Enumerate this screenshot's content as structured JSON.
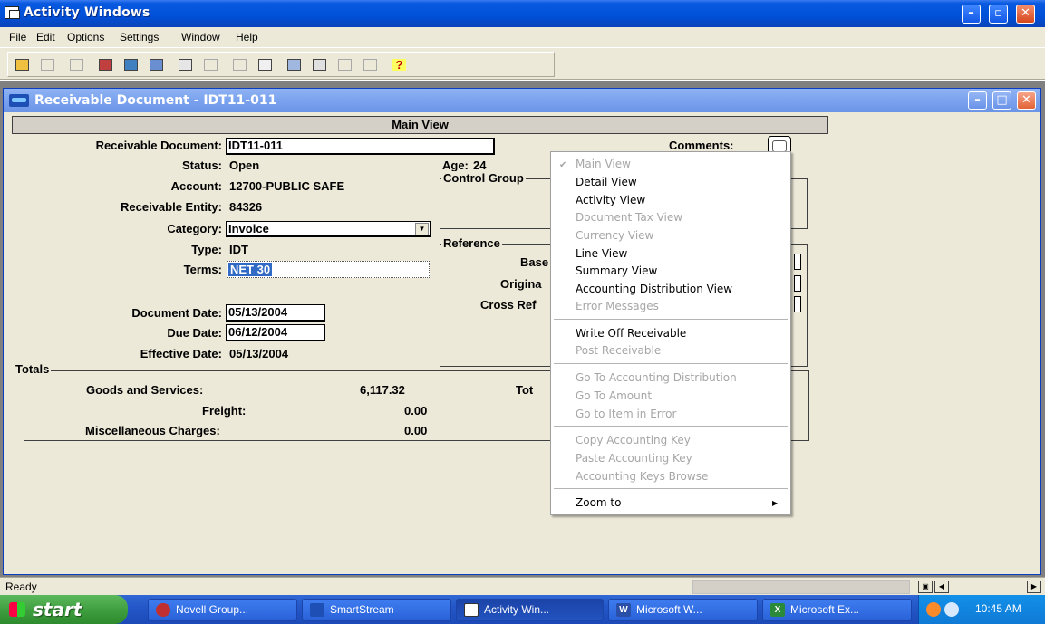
{
  "app": {
    "title": "Activity Windows",
    "menu": [
      "File",
      "Edit",
      "Options",
      "Settings",
      "Window",
      "Help"
    ]
  },
  "child": {
    "title": "Receivable Document -  IDT11-011",
    "view_title": "Main View"
  },
  "form": {
    "receivable_document_label": "Receivable Document:",
    "receivable_document": "IDT11-011",
    "status_label": "Status:",
    "status": "Open",
    "account_label": "Account:",
    "account": "12700-PUBLIC SAFE",
    "receivable_entity_label": "Receivable Entity:",
    "receivable_entity": "84326",
    "category_label": "Category:",
    "category": "Invoice",
    "type_label": "Type:",
    "type": "IDT",
    "terms_label": "Terms:",
    "terms": "NET 30",
    "document_date_label": "Document Date:",
    "document_date": "05/13/2004",
    "due_date_label": "Due Date:",
    "due_date": "06/12/2004",
    "effective_date_label": "Effective Date:",
    "effective_date": "05/13/2004",
    "age_label": "Age:",
    "age": "24",
    "comments_label": "Comments:",
    "control_group_title": "Control Group",
    "reference_title": "Reference",
    "reference_labels": [
      "Base",
      "Origina",
      "Cross Ref"
    ]
  },
  "totals": {
    "title": "Totals",
    "goods_label": "Goods and Services:",
    "goods_value": "6,117.32",
    "freight_label": "Freight:",
    "freight_value": "0.00",
    "misc_label": "Miscellaneous Charges:",
    "misc_value": "0.00",
    "total_label": "Tot"
  },
  "context_menu": {
    "items": [
      {
        "label": "Main View",
        "enabled": false,
        "checked": true
      },
      {
        "label": "Detail View",
        "enabled": true
      },
      {
        "label": "Activity View",
        "enabled": true
      },
      {
        "label": "Document Tax View",
        "enabled": false
      },
      {
        "label": "Currency View",
        "enabled": false
      },
      {
        "label": "Line View",
        "enabled": true
      },
      {
        "label": "Summary View",
        "enabled": true
      },
      {
        "label": "Accounting Distribution View",
        "enabled": true
      },
      {
        "label": "Error Messages",
        "enabled": false
      },
      {
        "label": "Write Off Receivable",
        "enabled": true
      },
      {
        "label": "Post Receivable",
        "enabled": false
      },
      {
        "label": "Go To Accounting Distribution",
        "enabled": false
      },
      {
        "label": "Go To Amount",
        "enabled": false
      },
      {
        "label": "Go to Item in Error",
        "enabled": false
      },
      {
        "label": "Copy Accounting Key",
        "enabled": false
      },
      {
        "label": "Paste Accounting Key",
        "enabled": false
      },
      {
        "label": "Accounting Keys Browse",
        "enabled": false
      },
      {
        "label": "Zoom to",
        "enabled": true,
        "submenu": true
      }
    ]
  },
  "status": {
    "text": "Ready"
  },
  "taskbar": {
    "start_label": "start",
    "tasks": [
      "Novell Group...",
      "SmartStream",
      "Activity Win...",
      "Microsoft W...",
      "Microsoft Ex..."
    ],
    "clock": "10:45 AM"
  },
  "colors": {
    "titlebar": "#0050d8",
    "child_titlebar": "#7aa2ee",
    "selection": "#316ac5",
    "disabled_text": "#a6a6a6",
    "taskbar": "#2457c8",
    "start": "#3b9b3b"
  }
}
